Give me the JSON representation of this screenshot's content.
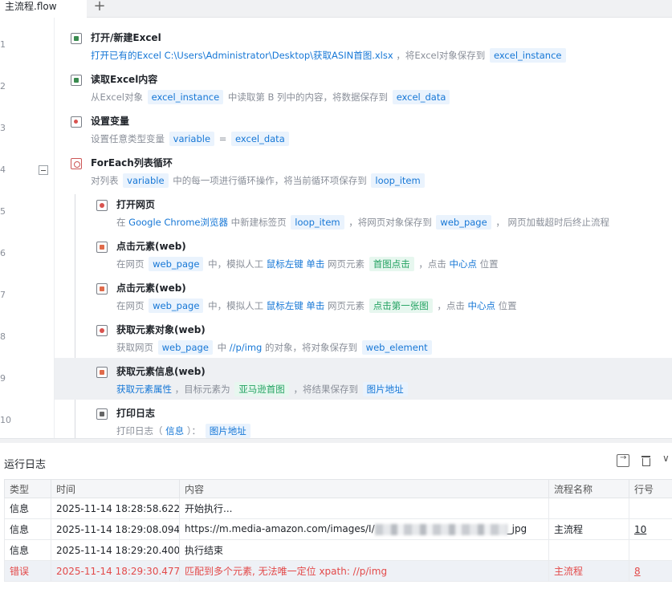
{
  "tabs": {
    "active_label": "主流程.flow",
    "add_label": "+"
  },
  "gutter": {
    "line_numbers": [
      "1",
      "2",
      "3",
      "4",
      "5",
      "6",
      "7",
      "8",
      "9",
      "10"
    ]
  },
  "steps": [
    {
      "title": "打开/新建Excel",
      "d": [
        "打开已有的Excel  C:\\Users\\Administrator\\Desktop\\获取ASIN首图.xlsx",
        "，将Excel对象保存到",
        "excel_instance"
      ]
    },
    {
      "title": "读取Excel内容",
      "d": [
        "从Excel对象",
        "excel_instance",
        "中读取第 B 列中的内容，将数据保存到",
        "excel_data"
      ]
    },
    {
      "title": "设置变量",
      "d": [
        "设置任意类型变量",
        "variable",
        "=",
        "excel_data"
      ]
    },
    {
      "title": "ForEach列表循环",
      "d": [
        "对列表",
        "variable",
        "中的每一项进行循环操作，将当前循环项保存到",
        "loop_item"
      ]
    },
    {
      "title": "打开网页",
      "d": [
        "在",
        "Google Chrome浏览器",
        "中新建标签页",
        "loop_item",
        "，将网页对象保存到",
        "web_page",
        "，",
        "网页加载超时后终止流程"
      ]
    },
    {
      "title": "点击元素(web)",
      "d": [
        "在网页",
        "web_page",
        "中，模拟人工",
        "鼠标左键",
        "单击",
        "网页元素",
        "首图点击",
        "，点击",
        "中心点",
        "位置"
      ]
    },
    {
      "title": "点击元素(web)",
      "d": [
        "在网页",
        "web_page",
        "中，模拟人工",
        "鼠标左键",
        "单击",
        "网页元素",
        "点击第一张图",
        "，点击",
        "中心点",
        "位置"
      ]
    },
    {
      "title": "获取元素对象(web)",
      "d": [
        "获取网页",
        "web_page",
        "中",
        "//p/img",
        "的对象，将对象保存到",
        "web_element"
      ]
    },
    {
      "title": "获取元素信息(web)",
      "d": [
        "获取元素属性",
        "，目标元素为",
        "亚马逊首图",
        "，将结果保存到",
        "图片地址"
      ]
    },
    {
      "title": "打印日志",
      "d": [
        "打印日志（",
        "信息",
        "）：",
        "图片地址"
      ]
    }
  ],
  "log": {
    "title": "运行日志",
    "columns": [
      "类型",
      "时间",
      "内容",
      "流程名称",
      "行号"
    ],
    "rows": [
      {
        "type": "信息",
        "time": "2025-11-14 18:28:58.622",
        "content": "开始执行...",
        "flow": "",
        "line": ""
      },
      {
        "type": "信息",
        "time": "2025-11-14 18:29:08.094",
        "content": "https://m.media-amazon.com/images/I/",
        "content_tail": "_jpg",
        "flow": "主流程",
        "line": "10"
      },
      {
        "type": "信息",
        "time": "2025-11-14 18:29:20.400",
        "content": "执行结束",
        "flow": "",
        "line": ""
      },
      {
        "type": "错误",
        "time": "2025-11-14 18:29:30.477",
        "content": "匹配到多个元素, 无法唯一定位 xpath: //p/img",
        "flow": "主流程",
        "line": "8"
      }
    ]
  },
  "colors": {
    "accent": "#1677d6",
    "tag_bg": "#eaf3fd",
    "green_tag": "#25a363",
    "error": "#e34a4a"
  }
}
